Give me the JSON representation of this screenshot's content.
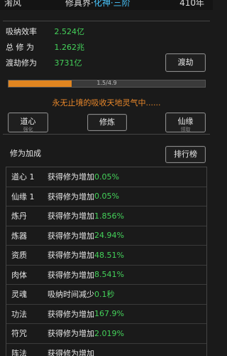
{
  "header": {
    "title": "淆风",
    "realm_main": "修真界·",
    "realm_sub": "化神·三阶",
    "year": "410年"
  },
  "stats": [
    {
      "label": "吸纳效率",
      "value": "2.524亿"
    },
    {
      "label": "总 修 为",
      "value": "1.262兆"
    },
    {
      "label": "渡劫修为",
      "value": "3731亿"
    }
  ],
  "buttons": {
    "dujie": "渡劫",
    "daoxin": "道心",
    "daoxin_sub": "强化",
    "xiulian": "修炼",
    "xianyuan": "仙缘",
    "xianyuan_sub": "领取",
    "leaderboard": "排行榜"
  },
  "progress": {
    "text": "1.5/4.9",
    "fraction": 0.32,
    "color": "#e08520"
  },
  "tip": "永无止境的吸收天地灵气中......",
  "bonus_section_title": "修为加成",
  "bonus_rows": [
    {
      "name": "道心 1",
      "desc": "获得修为增加",
      "value": "0.05%"
    },
    {
      "name": "仙缘 1",
      "desc": "获得修为增加",
      "value": "0.05%"
    },
    {
      "name": "炼丹",
      "desc": "获得修为增加",
      "value": "1.856%"
    },
    {
      "name": "炼器",
      "desc": "获得修为增加",
      "value": "24.94%"
    },
    {
      "name": "资质",
      "desc": "获得修为增加",
      "value": "48.51%"
    },
    {
      "name": "肉体",
      "desc": "获得修为增加",
      "value": "8.541%"
    },
    {
      "name": "灵魂",
      "desc": "吸纳时间减少",
      "value": "0.1秒"
    },
    {
      "name": "功法",
      "desc": "获得修为增加",
      "value": "167.9%"
    },
    {
      "name": "符咒",
      "desc": "获得修为增加",
      "value": "2.019%"
    },
    {
      "name": "阵法",
      "desc": "获得修为增加",
      "value": ""
    }
  ]
}
